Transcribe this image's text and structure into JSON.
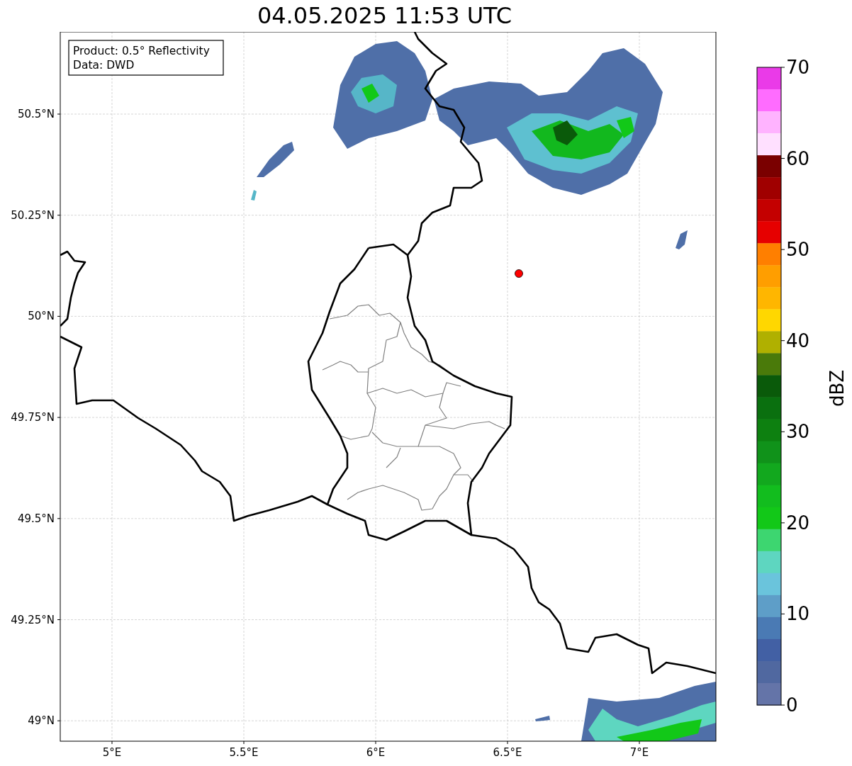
{
  "title": "04.05.2025 11:53 UTC",
  "info_box": {
    "lines": [
      "Product: 0.5° Reflectivity",
      "Data: DWD"
    ]
  },
  "map": {
    "x_ticks": [
      "5°E",
      "5.5°E",
      "6°E",
      "6.5°E",
      "7°E"
    ],
    "y_ticks": [
      "50.5°N",
      "50.25°N",
      "50°N",
      "49.75°N",
      "49.5°N",
      "49.25°N",
      "49°N"
    ]
  },
  "colorbar": {
    "label": "dBZ",
    "ticks": [
      "70",
      "60",
      "50",
      "40",
      "30",
      "20",
      "10",
      "0"
    ],
    "segments": [
      {
        "color": "#ea3ae8"
      },
      {
        "color": "#ff6cff"
      },
      {
        "color": "#ffb3ff"
      },
      {
        "color": "#ffe0ff"
      },
      {
        "color": "#7a0000"
      },
      {
        "color": "#a00000"
      },
      {
        "color": "#c40000"
      },
      {
        "color": "#e60000"
      },
      {
        "color": "#ff7f00"
      },
      {
        "color": "#ff9e00"
      },
      {
        "color": "#ffb600"
      },
      {
        "color": "#ffd700"
      },
      {
        "color": "#b0b000"
      },
      {
        "color": "#4a7a0a"
      },
      {
        "color": "#0a5a0a"
      },
      {
        "color": "#0a700f"
      },
      {
        "color": "#0d8010"
      },
      {
        "color": "#10921a"
      },
      {
        "color": "#12a81e"
      },
      {
        "color": "#12bd1e"
      },
      {
        "color": "#12c818"
      },
      {
        "color": "#3dd670"
      },
      {
        "color": "#5ed6c0"
      },
      {
        "color": "#6ac4dc"
      },
      {
        "color": "#5e9ec8"
      },
      {
        "color": "#4a7ab4"
      },
      {
        "color": "#4260a4"
      },
      {
        "color": "#5068a0"
      },
      {
        "color": "#6474a8"
      }
    ]
  }
}
